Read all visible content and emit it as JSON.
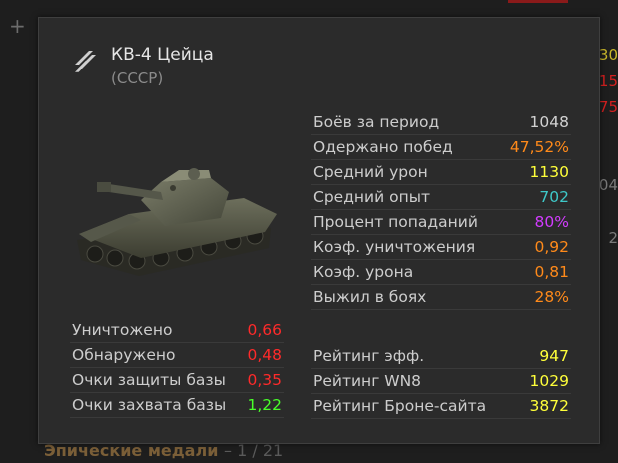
{
  "colors": {
    "white": "#d2d2d2",
    "orange": "#ff8a1a",
    "yellow": "#ffff3a",
    "teal": "#3ec8c8",
    "purple": "#d23cff",
    "red": "#ff2a2a",
    "green": "#49ff2a"
  },
  "background": {
    "bottom_label": "Эпические медали",
    "bottom_count": "– 1 / 21"
  },
  "tank": {
    "name": "КВ-4 Цейца",
    "nation": "(СССР)",
    "rank_icon": "triple-chevron-rank-icon",
    "image": "heavy-tank-image"
  },
  "period_stats": [
    {
      "label": "Боёв за период",
      "value": "1048",
      "color": "#d2d2d2"
    },
    {
      "label": "Одержано побед",
      "value": "47,52%",
      "color": "#ff8a1a"
    },
    {
      "label": "Средний урон",
      "value": "1130",
      "color": "#ffff3a"
    },
    {
      "label": "Средний опыт",
      "value": "702",
      "color": "#3ec8c8"
    },
    {
      "label": "Процент попаданий",
      "value": "80%",
      "color": "#d23cff"
    },
    {
      "label": "Коэф. уничтожения",
      "value": "0,92",
      "color": "#ff8a1a"
    },
    {
      "label": "Коэф. урона",
      "value": "0,81",
      "color": "#ff8a1a"
    },
    {
      "label": "Выжил в боях",
      "value": "28%",
      "color": "#ff8a1a"
    }
  ],
  "average_stats": [
    {
      "label": "Уничтожено",
      "value": "0,66",
      "color": "#ff2a2a"
    },
    {
      "label": "Обнаружено",
      "value": "0,48",
      "color": "#ff2a2a"
    },
    {
      "label": "Очки защиты базы",
      "value": "0,35",
      "color": "#ff2a2a"
    },
    {
      "label": "Очки захвата базы",
      "value": "1,22",
      "color": "#49ff2a"
    }
  ],
  "ratings": [
    {
      "label": "Рейтинг эфф.",
      "value": "947",
      "color": "#ffff3a"
    },
    {
      "label": "Рейтинг WN8",
      "value": "1029",
      "color": "#ffff3a"
    },
    {
      "label": "Рейтинг Броне-сайта",
      "value": "3872",
      "color": "#ffff3a"
    }
  ]
}
